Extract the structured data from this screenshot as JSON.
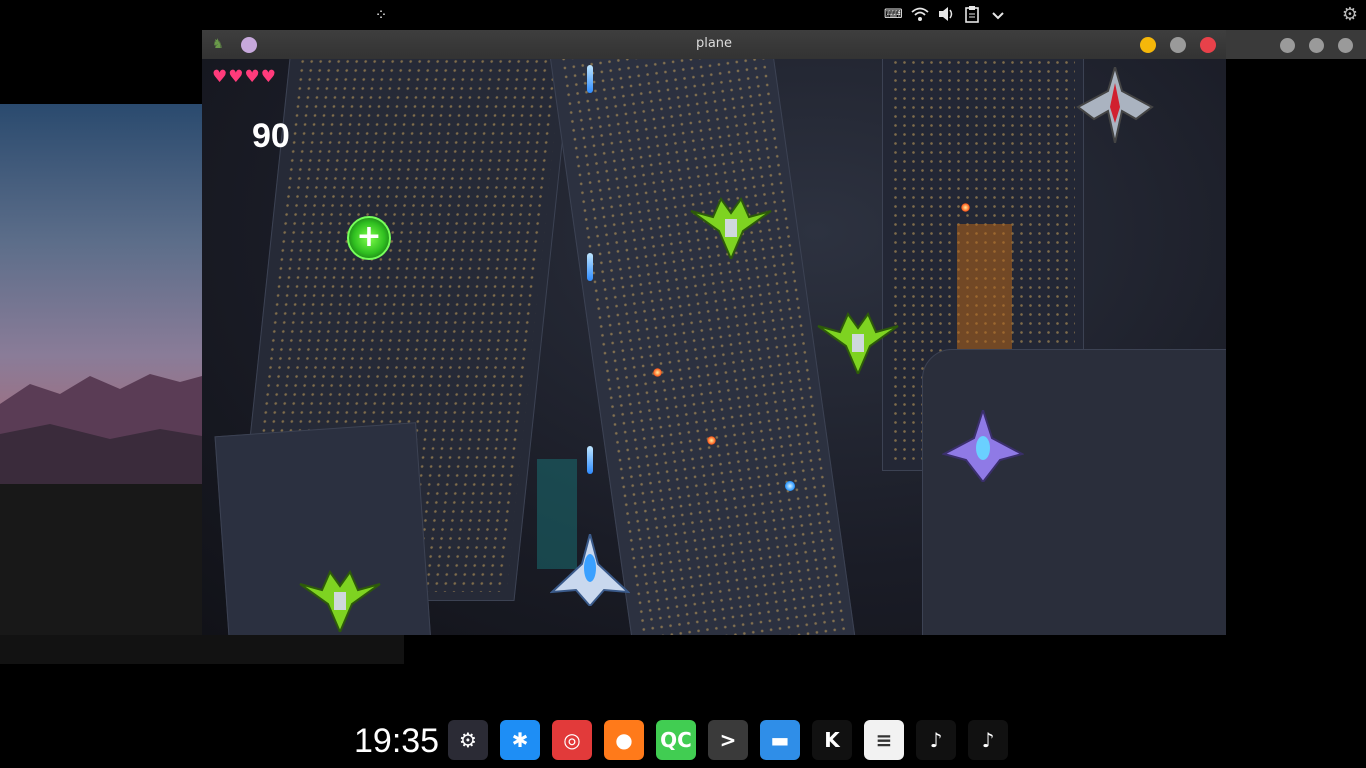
{
  "top_panel": {
    "launcher_icon": "launcher-dots-icon",
    "tray_icons": [
      "keyboard-icon",
      "wifi-icon",
      "volume-icon",
      "clipboard-icon",
      "chevron-down-icon"
    ],
    "settings_icon": "gear-icon"
  },
  "window": {
    "title": "plane",
    "buttons": {
      "minimize_color": "#f5b70a",
      "maximize_color": "#9a9a9a",
      "close_color": "#e8414a"
    }
  },
  "game": {
    "lives": 4,
    "hearts": "♥♥♥♥",
    "score": "90",
    "powerup_symbol": "+"
  },
  "dock": {
    "clock": "19:35",
    "apps": [
      {
        "name": "control-center",
        "glyph": "⚙",
        "color": "#2b2b35"
      },
      {
        "name": "tencent-qq",
        "glyph": "✱",
        "color": "#1e8ef5"
      },
      {
        "name": "netease-music",
        "glyph": "◎",
        "color": "#e23a3a"
      },
      {
        "name": "firefox",
        "glyph": "●",
        "color": "#ff7a1a"
      },
      {
        "name": "qt-creator",
        "glyph": "QC",
        "color": "#41cd52"
      },
      {
        "name": "terminal",
        "glyph": ">",
        "color": "#3a3a3a"
      },
      {
        "name": "file-manager",
        "glyph": "▬",
        "color": "#2f8ee8"
      },
      {
        "name": "kingsoft",
        "glyph": "K",
        "color": "#111111"
      },
      {
        "name": "text-editor",
        "glyph": "≡",
        "color": "#f2f2f2"
      },
      {
        "name": "plane-game-1",
        "glyph": "♪",
        "color": "#111111"
      },
      {
        "name": "plane-game-2",
        "glyph": "♪",
        "color": "#111111"
      }
    ]
  }
}
